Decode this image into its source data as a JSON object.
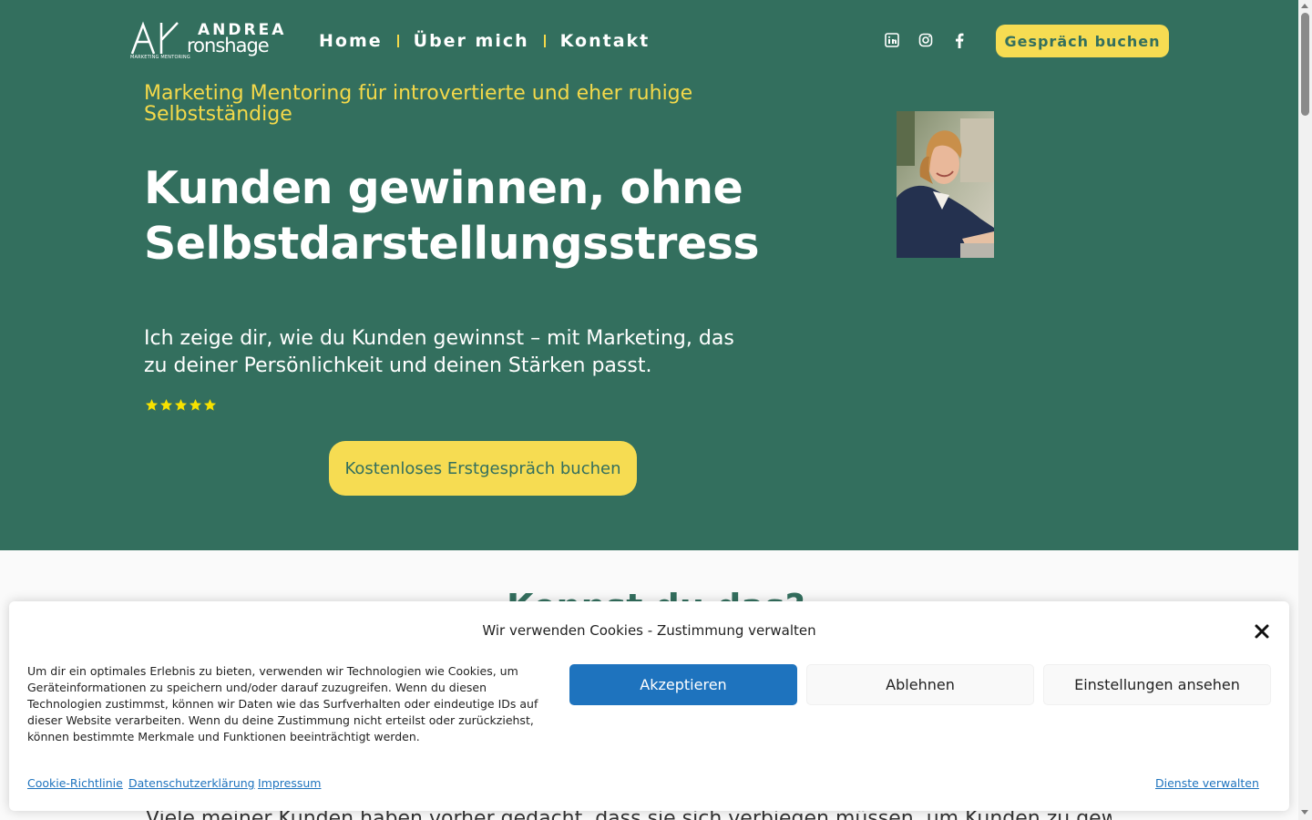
{
  "brand": {
    "first_name": "ANDREA",
    "last_name": "ronshage",
    "initials": "AK",
    "subtitle": "MARKETING MENTORING"
  },
  "nav": {
    "items": [
      {
        "label": "Home"
      },
      {
        "label": "Über mich"
      },
      {
        "label": "Kontakt"
      }
    ]
  },
  "social": {
    "icons": [
      "linkedin-icon",
      "instagram-icon",
      "facebook-icon"
    ]
  },
  "header": {
    "cta_label": "Gespräch buchen"
  },
  "hero": {
    "tagline": "Marketing Mentoring für introvertierte und eher ruhige Selbstständige",
    "headline": "Kunden gewinnen, ohne Selbstdarstellungsstress",
    "lead": "Ich zeige dir, wie du Kunden gewinnst – mit Marketing, das zu deiner Persönlichkeit und deinen Stärken passt.",
    "rating": {
      "value": 5,
      "max": 5
    },
    "cta_label": "Kostenloses Erstgespräch buchen"
  },
  "below": {
    "heading": "Kennst du das?",
    "text": "Viele meiner Kunden haben vorher gedacht, dass sie sich verbiegen müssen, um Kunden zu gewinnen. Sie haben ihre Stärken nicht"
  },
  "cookie_banner": {
    "title": "Wir verwenden Cookies - Zustimmung verwalten",
    "text": "Um dir ein optimales Erlebnis zu bieten, verwenden wir Technologien wie Cookies, um Geräteinformationen zu speichern und/oder darauf zuzugreifen. Wenn du diesen Technologien zustimmst, können wir Daten wie das Surfverhalten oder eindeutige IDs auf dieser Website verarbeiten. Wenn du deine Zustimmung nicht erteilst oder zurückziehst, können bestimmte Merkmale und Funktionen beeinträchtigt werden.",
    "accept_label": "Akzeptieren",
    "deny_label": "Ablehnen",
    "settings_label": "Einstellungen ansehen",
    "links": {
      "cookie_policy": "Cookie-Richtlinie",
      "privacy": "Datenschutzerklärung",
      "imprint": "Impressum",
      "manage": "Dienste verwalten"
    }
  },
  "colors": {
    "primary_green": "#336f5e",
    "accent_yellow": "#f6dc52",
    "button_blue": "#1e73be"
  }
}
